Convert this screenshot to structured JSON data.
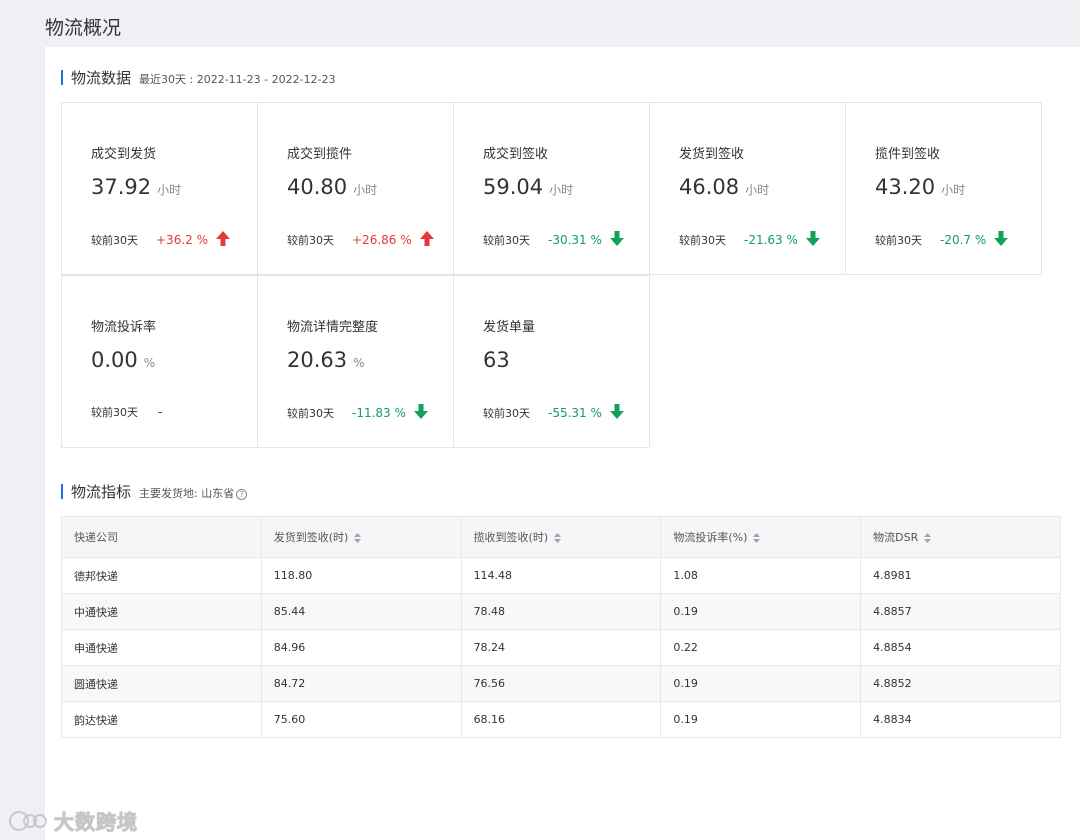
{
  "page_title": "物流概况",
  "logistics_data": {
    "title": "物流数据",
    "date_range": "最近30天 : 2022-11-23 - 2022-12-23",
    "compare_label": "较前30天",
    "cards": [
      {
        "label": "成交到发货",
        "value": "37.92",
        "unit": "小时",
        "change": "+36.2 %",
        "trend": "up"
      },
      {
        "label": "成交到揽件",
        "value": "40.80",
        "unit": "小时",
        "change": "+26.86 %",
        "trend": "up"
      },
      {
        "label": "成交到签收",
        "value": "59.04",
        "unit": "小时",
        "change": "-30.31 %",
        "trend": "down"
      },
      {
        "label": "发货到签收",
        "value": "46.08",
        "unit": "小时",
        "change": "-21.63 %",
        "trend": "down"
      },
      {
        "label": "揽件到签收",
        "value": "43.20",
        "unit": "小时",
        "change": "-20.7 %",
        "trend": "down"
      },
      {
        "label": "物流投诉率",
        "value": "0.00",
        "unit": "%",
        "change": "-",
        "trend": "flat"
      },
      {
        "label": "物流详情完整度",
        "value": "20.63",
        "unit": "%",
        "change": "-11.83 %",
        "trend": "down"
      },
      {
        "label": "发货单量",
        "value": "63",
        "unit": "",
        "change": "-55.31 %",
        "trend": "down"
      }
    ]
  },
  "logistics_index": {
    "title": "物流指标",
    "origin": "主要发货地: 山东省",
    "help_icon": "question-circle-icon",
    "columns": [
      "快递公司",
      "发货到签收(时)",
      "揽收到签收(时)",
      "物流投诉率(%)",
      "物流DSR"
    ],
    "rows": [
      [
        "德邦快递",
        "118.80",
        "114.48",
        "1.08",
        "4.8981"
      ],
      [
        "中通快递",
        "85.44",
        "78.48",
        "0.19",
        "4.8857"
      ],
      [
        "申通快递",
        "84.96",
        "78.24",
        "0.22",
        "4.8854"
      ],
      [
        "圆通快递",
        "84.72",
        "76.56",
        "0.19",
        "4.8852"
      ],
      [
        "韵达快递",
        "75.60",
        "68.16",
        "0.19",
        "4.8834"
      ]
    ]
  },
  "watermark": "大数跨境",
  "colors": {
    "up": "#e63939",
    "down": "#12a05a",
    "accent": "#1f6fe0"
  }
}
